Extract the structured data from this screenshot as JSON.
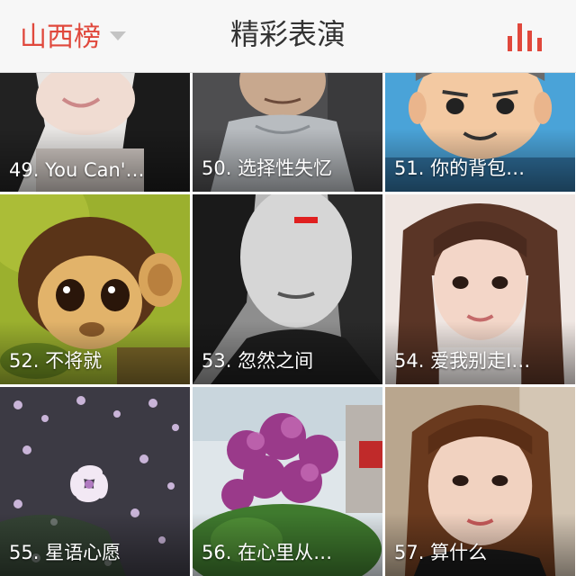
{
  "header": {
    "region_label": "山西榜",
    "title": "精彩表演",
    "chart_icon": "bar-chart-icon",
    "accent_color": "#e0483c"
  },
  "tiles": [
    {
      "caption": "49. You Can'…",
      "image": "photo-girl-long-hair"
    },
    {
      "caption": "50. 选择性失忆",
      "image": "photo-boy-tshirt"
    },
    {
      "caption": "51. 你的背包…",
      "image": "cartoon-face-avatar"
    },
    {
      "caption": "52. 不将就",
      "image": "painting-monkey"
    },
    {
      "caption": "53. 忽然之间",
      "image": "photo-bw-girl"
    },
    {
      "caption": "54. 爱我别走I…",
      "image": "photo-girl-bangs"
    },
    {
      "caption": "55. 星语心愿",
      "image": "photo-flower-petals"
    },
    {
      "caption": "56. 在心里从…",
      "image": "photo-purple-blossom-tree"
    },
    {
      "caption": "57. 算什么",
      "image": "photo-woman-selfie"
    }
  ]
}
